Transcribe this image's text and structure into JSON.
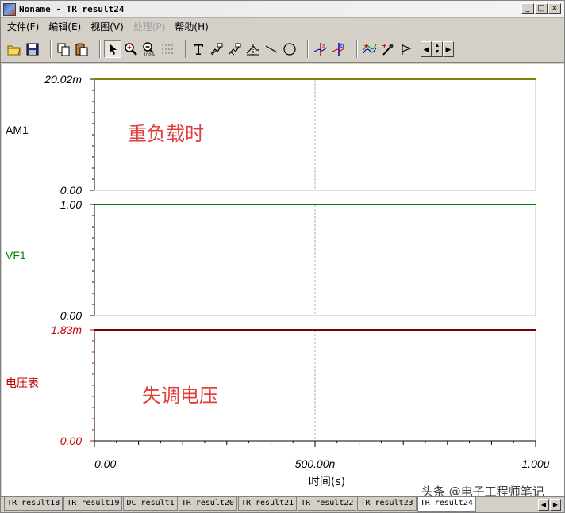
{
  "window": {
    "title": "Noname - TR result24",
    "buttons": [
      "_",
      "□",
      "×"
    ]
  },
  "menu": [
    {
      "label": "文件(F)",
      "enabled": true
    },
    {
      "label": "编辑(E)",
      "enabled": true
    },
    {
      "label": "视图(V)",
      "enabled": true
    },
    {
      "label": "处理(P)",
      "enabled": false
    },
    {
      "label": "帮助(H)",
      "enabled": true
    }
  ],
  "toolbar": {
    "icons": [
      "open-folder-icon",
      "save-icon",
      "copy-icon",
      "paste-icon",
      "pointer-icon",
      "zoom-in-icon",
      "zoom-100-icon",
      "grid-icon",
      "text-icon",
      "cursor-label-icon",
      "cursor-label2-icon",
      "peak-icon",
      "line-icon",
      "ellipse-icon",
      "cursor-a-icon",
      "cursor-b-icon",
      "curve-add-icon",
      "probe-icon",
      "marker-icon",
      "nav-left-icon",
      "nav-updown-icon",
      "nav-right-icon"
    ]
  },
  "plots": [
    {
      "label": "AM1",
      "label_color": "#000000",
      "trace_color": "#808000",
      "ymax_label": "20.02m",
      "ymin_label": "0.00",
      "tick_color": "#000000",
      "annotation": "重负载时"
    },
    {
      "label": "VF1",
      "label_color": "#008000",
      "trace_color": "#008000",
      "ymax_label": "1.00",
      "ymin_label": "0.00",
      "tick_color": "#000000",
      "annotation": ""
    },
    {
      "label": "电压表",
      "label_color": "#c00000",
      "trace_color": "#800000",
      "ymax_label": "1.83m",
      "ymin_label": "0.00",
      "tick_color": "#c00000",
      "annotation": "失调电压"
    }
  ],
  "xaxis": {
    "ticks": [
      "0.00",
      "500.00n",
      "1.00u"
    ],
    "label": "时间(s)"
  },
  "watermark": "头条 @电子工程师笔记",
  "tabs": [
    {
      "label": "TR result18",
      "active": false
    },
    {
      "label": "TR result19",
      "active": false
    },
    {
      "label": "DC result1",
      "active": false
    },
    {
      "label": "TR result20",
      "active": false
    },
    {
      "label": "TR result21",
      "active": false
    },
    {
      "label": "TR result22",
      "active": false
    },
    {
      "label": "TR result23",
      "active": false
    },
    {
      "label": "TR result24",
      "active": true
    }
  ]
}
